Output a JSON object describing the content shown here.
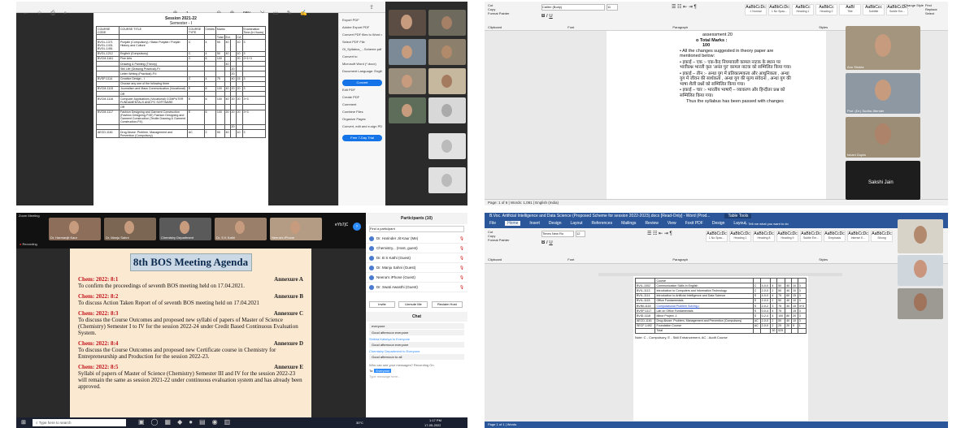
{
  "panel1": {
    "toolbar_page": "1",
    "toolbar_zoom": "98%",
    "doc_title": "Session 2021-22",
    "doc_subtitle": "Semester - I",
    "table_headers": [
      "COURSE CODE",
      "COURSE TITLE",
      "COURSE TYPE",
      "Credits",
      "Marks",
      "Examination Time (in Hours)"
    ],
    "subheaders": [
      "Total",
      "Ext.",
      "CA",
      "L",
      "P"
    ],
    "rows": [
      [
        "BVGL-1371 BVGL-1431 BVGL-1451",
        "Punjabi (Compulsory) / Basic Punjabi / Punjab History and Culture",
        "C",
        "4",
        "50",
        "40",
        "",
        "10",
        "3"
      ],
      [
        "BVGL-1212",
        "English (Compulsory)",
        "C",
        "4",
        "50",
        "40",
        "",
        "10",
        "3"
      ],
      [
        "BVCM-1161",
        "Fine Arts",
        "C",
        "6",
        "100",
        "",
        "",
        "20",
        "2+1+3"
      ],
      [
        "",
        "Drawing & Painting (Theory)",
        "",
        "",
        "",
        "40",
        "",
        "",
        ""
      ],
      [
        "",
        "Still Life (Drawing Practical)-P.I",
        "",
        "",
        "",
        "",
        "20",
        "",
        ""
      ],
      [
        "",
        "Letter Writing (Practical)-P.II",
        "",
        "",
        "",
        "",
        "20",
        "",
        ""
      ],
      [
        "BVSP-1114",
        "Creative Design - I",
        "C",
        "4",
        "75",
        "",
        "40",
        "15",
        "3"
      ],
      [
        "",
        "Choose any one of the following three",
        "",
        "",
        "",
        "",
        "",
        "",
        ""
      ],
      [
        "BVCM-1115",
        "Journalism and Mass Communication (Vocational)",
        "E",
        "6",
        "100",
        "40",
        "20",
        "20",
        "3"
      ],
      [
        "",
        "OR",
        "",
        "",
        "",
        "",
        "",
        "",
        ""
      ],
      [
        "BVCM-1116",
        "Computer Applications (Vocational) COMPUTER FUNDAMENTALS AND PC SOFTWARE",
        "E",
        "6",
        "100",
        "40",
        "20",
        "20",
        "3+3"
      ],
      [
        "",
        "OR",
        "",
        "",
        "",
        "",
        "",
        "",
        ""
      ],
      [
        "BVCM-1117",
        "Fashion Designing and Garment Construction (Fashion Designing-P.I/E) Fashion Designing and Garment Construction (Textile Drawing & Garment Construction-P.II)",
        "E",
        "6",
        "100",
        "20",
        "20",
        "20",
        "3+3"
      ],
      [
        "",
        "",
        "",
        "",
        "",
        "",
        "20",
        "",
        ""
      ],
      [
        "AECD-1161",
        "Drug Abuse: Problem, Management and Prevention (Compulsory)",
        "AC",
        "2",
        "50",
        "40",
        "",
        "10",
        "3"
      ]
    ],
    "side_items": [
      "Export PDF",
      "Adobe Export PDF",
      "Convert PDF files to Word or Excel Online",
      "Select PDF File",
      "Ol_Syllabus_...Scheme.pdf",
      "Convert to",
      "Microsoft Word (*.docx)",
      "Document Language: English (U.S.) Change",
      "Convert",
      "Edit PDF",
      "Create PDF",
      "Comment",
      "Combine Files",
      "Organize Pages",
      "Convert, edit and e-sign PDF forms & agreements",
      "Free 7-Day Trial"
    ],
    "videos": [
      {
        "name": ""
      },
      {
        "name": ""
      },
      {
        "name": ""
      },
      {
        "name": ""
      },
      {
        "name": ""
      },
      {
        "name": ""
      },
      {
        "name": ""
      },
      {
        "name": ""
      },
      {
        "name": ""
      },
      {
        "name": ""
      }
    ]
  },
  "panel2": {
    "clipboard": [
      "Cut",
      "Copy",
      "Format Painter"
    ],
    "font_name": "Calibri (Body)",
    "font_size": "11",
    "styles": [
      [
        "AaBbCcDc",
        "1 Normal"
      ],
      [
        "AaBbCcDc",
        "1 No Spac..."
      ],
      [
        "AaBbCc",
        "Heading 1"
      ],
      [
        "AaBbCc",
        "Heading 2"
      ],
      [
        "AaBl",
        "Title"
      ],
      [
        "AaBbCcc",
        "Subtitle"
      ],
      [
        "AaBbCcDc",
        "Subtle Em..."
      ]
    ],
    "groups": [
      "Clipboard",
      "Font",
      "Paragraph",
      "Styles"
    ],
    "editing": [
      "Find",
      "Replace",
      "Select"
    ],
    "change_styles": "Change Styles",
    "doc_lines": [
      "assessment 20",
      "o  Total  Marks  :",
      "100"
    ],
    "bullets": [
      "All  the  changes suggested in theory paper are mentioned below:",
      "इकाई – एक :- एक-कैद नियमावली कामल नाटक के स्थान पर भावीप्रश्न भारती कृत 'अनंत पुर' कामल नाटक को सम्मिलित किया गया।",
      "इकाई – तीन :- अन्धा युग में प्रतिकात्मकता और आधुनिकता , अन्धा युग में जीवन की सार्थकता , अन्धा युग की मूल्य संवेदना , अन्धा युग की भाषा शैली प्रश्नों को सम्मिलित किया गया।",
      "इकाई – चार :- भारतीय भाषाएँ – व्याकरण और हिन्दीतर प्रश्न को सम्मिलित किया गया।"
    ],
    "closing": "Thus the syllabus has been passed with changes",
    "status": "Page: 1 of 6  |  Words: 1,081  |  English (India)",
    "videos": [
      {
        "name": "Anu Shukla"
      },
      {
        "name": "Prof. (Dr.) Sudha Jitender"
      },
      {
        "name": "Ishani Gupta"
      },
      {
        "name": "Sakshi Jain"
      }
    ]
  },
  "panel3": {
    "app_title": "Zoom Meeting",
    "recording": "Recording",
    "meeting_id": "eYb7jC",
    "top_videos": [
      {
        "name": "Dr. Harmanjit Kaur"
      },
      {
        "name": "Dr. Manju Sahni"
      },
      {
        "name": "Chemistry Department"
      },
      {
        "name": "Dr. S K Kathi"
      },
      {
        "name": "Neena's iPhone"
      }
    ],
    "slide_title": "8th BOS Meeting Agenda",
    "agenda": [
      {
        "code": "Chem: 2022: 8:1",
        "annex": "Annexure A",
        "text": "To confirm the proceedings of seventh BOS meeting held on 17.04.2021."
      },
      {
        "code": "Chem: 2022: 8:2",
        "annex": "Annexure B",
        "text": "To discuss Action Taken Report of of seventh BOS meeting held on 17.04.2021"
      },
      {
        "code": "Chem: 2022: 8:3",
        "annex": "Annexure C",
        "text": "To discuss the Course Outcomes and proposed new syllabi of papers of Master of Science (Chemistry) Semester I to IV for the session 2022-24 under Credit Based Continuous Evaluation System."
      },
      {
        "code": "Chem: 2022: 8:4",
        "annex": "Annexure D",
        "text": "To discuss the Course Outcomes and proposed new Certificate course in Chemistry for Entrepreneurship and Production for the session 2022-23."
      },
      {
        "code": "Chem: 2022: 8:5",
        "annex": "Annexure E",
        "text": "Syllabi of papers of Master of Science (Chemistry) Semester III and IV for the session 2022-23 will remain the same as session 2021-22 under continuous evaluation system and has already been approved."
      }
    ],
    "participants_title": "Participants (10)",
    "participants_search": "Find a participant",
    "participants": [
      "Dr. Harinder Jit Kaur (Me)",
      "Chemistry... (Host, guest)",
      "Dr. B S Kathi (Guest)",
      "Dr. Manju Sahni (Guest)",
      "Neena's iPhone (Guest)",
      "Dr. Swati Awasthi (Guest)"
    ],
    "buttons": [
      "Invite",
      "Unmute Me",
      "Reclaim Host"
    ],
    "chat_title": "Chat",
    "chat": [
      "everyone",
      "Good afternoon everyone",
      "Shikha Kalsriya to Everyone",
      "Good afternoon everyone",
      "Chemistry Department to Everyone",
      "Good afternoon to all"
    ],
    "chat_to": "Everyone",
    "chat_placeholder": "Type message here...",
    "chat_note": "Who can see your messages? Recording On",
    "taskbar_search": "Type here to search",
    "weather": "30°C",
    "time": "1:17 PM",
    "date": "17-05-2022"
  },
  "panel4": {
    "title": "B.Voc. Artificial Intelligence and Data Science (Proposed Scheme for session 2022-2023).docx [Read-Only] - Word (Prod...",
    "table_tools": "Table Tools",
    "tabs": [
      "File",
      "Home",
      "Insert",
      "Design",
      "Layout",
      "References",
      "Mailings",
      "Review",
      "View",
      "Foxit PDF",
      "Design",
      "Layout"
    ],
    "tell_me": "Tell me what you want to do",
    "font_name": "Times New Ro",
    "font_size": "12",
    "clipboard": [
      "Cut",
      "Copy",
      "Format Painter"
    ],
    "styles": [
      [
        "AaBbCcDc",
        "1 No Spac..."
      ],
      [
        "AaBbCcDc",
        "Heading 1"
      ],
      [
        "AaBbCcDc",
        "Heading 8"
      ],
      [
        "AaBbCcDc",
        "Heading 9"
      ],
      [
        "AaBbCcDc",
        "Subtle Em..."
      ],
      [
        "AaBbCcDc",
        "Emphasis"
      ],
      [
        "AaBbCcDc",
        "Intense E..."
      ],
      [
        "AaBbCcDc",
        "Strong"
      ]
    ],
    "groups": [
      "Clipboard",
      "Font",
      "Paragraph",
      "Styles"
    ],
    "rows": [
      [
        "",
        "Course",
        "",
        "",
        "",
        "",
        "",
        "",
        ""
      ],
      [
        "BVIL-1002",
        "Communication Skills in English",
        "C",
        "4-0-0",
        "4",
        "50",
        "40",
        "10",
        "3"
      ],
      [
        "BVIL-1113",
        "Introduction to Computers and Information Technology",
        "C",
        "2-0-0",
        "2",
        "50",
        "40",
        "10",
        "3"
      ],
      [
        "BVIL-1114",
        "Introduction to Artificial Intelligence and Data Science",
        "S",
        "4-0-0",
        "4",
        "75",
        "60",
        "15",
        "3"
      ],
      [
        "BVIL-1115",
        "Office Fundamentals",
        "S",
        "2-0-0",
        "2",
        "50",
        "40",
        "10",
        "3"
      ],
      [
        "BVIM-1116",
        "Computational Problem Solving-I",
        "S",
        "2-0-2",
        "3",
        "75",
        "40",
        "15",
        "3+3"
      ],
      [
        "BVSP-1117",
        "Lab on Office Fundamentals",
        "S",
        "0-0-4",
        "4",
        "75",
        "",
        "15",
        "3"
      ],
      [
        "BVID-1118",
        "Minor Project -1",
        "S",
        "0-2-4",
        "4",
        "100",
        "80",
        "20",
        "3"
      ],
      [
        "AECD-1161",
        "Drug Abuse: Problem, Management and Prevention (Compulsory)",
        "AC",
        "2-0-0",
        "2",
        "50",
        "40",
        "10",
        "3"
      ],
      [
        "SECF-1492",
        "Foundation Course",
        "AC",
        "2-0-0",
        "2",
        "25",
        "20",
        "5",
        "1"
      ],
      [
        "",
        "Total",
        "",
        "",
        "30",
        "525",
        "",
        "",
        ""
      ]
    ],
    "note": "Note: C - Compulsory, E - Skill Enhancement, AC - Audit Course",
    "status": "Page 1 of 1  |  Words",
    "videos": [
      {
        "name": ""
      },
      {
        "name": ""
      },
      {
        "name": ""
      }
    ]
  }
}
